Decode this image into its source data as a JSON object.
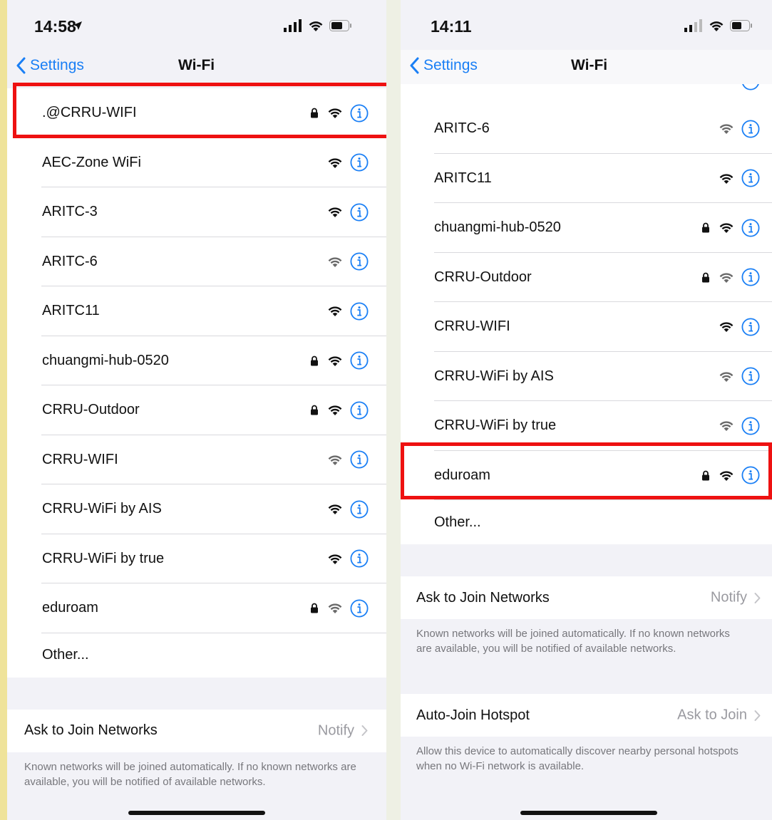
{
  "left": {
    "status": {
      "time": "14:58"
    },
    "nav": {
      "back_label": "Settings",
      "title": "Wi-Fi"
    },
    "networks": [
      {
        "name": ".@CRRU-WIFI",
        "secured": true
      },
      {
        "name": "AEC-Zone WiFi",
        "secured": false
      },
      {
        "name": "ARITC-3",
        "secured": false
      },
      {
        "name": "ARITC-6",
        "secured": false
      },
      {
        "name": "ARITC11",
        "secured": false
      },
      {
        "name": "chuangmi-hub-0520",
        "secured": true
      },
      {
        "name": "CRRU-Outdoor",
        "secured": true
      },
      {
        "name": "CRRU-WIFI",
        "secured": false
      },
      {
        "name": "CRRU-WiFi by AIS",
        "secured": false
      },
      {
        "name": "CRRU-WiFi by true",
        "secured": false
      },
      {
        "name": "eduroam",
        "secured": true
      }
    ],
    "other_label": "Other...",
    "ask_to_join": {
      "label": "Ask to Join Networks",
      "value": "Notify",
      "footnote": "Known networks will be joined automatically. If no known networks are available, you will be notified of available networks."
    }
  },
  "right": {
    "status": {
      "time": "14:11"
    },
    "nav": {
      "back_label": "Settings",
      "title": "Wi-Fi"
    },
    "networks": [
      {
        "name": "ARITC-6",
        "secured": false
      },
      {
        "name": "ARITC11",
        "secured": false
      },
      {
        "name": "chuangmi-hub-0520",
        "secured": true
      },
      {
        "name": "CRRU-Outdoor",
        "secured": true
      },
      {
        "name": "CRRU-WIFI",
        "secured": false
      },
      {
        "name": "CRRU-WiFi by AIS",
        "secured": false
      },
      {
        "name": "CRRU-WiFi by true",
        "secured": false
      },
      {
        "name": "eduroam",
        "secured": true
      }
    ],
    "other_label": "Other...",
    "ask_to_join": {
      "label": "Ask to Join Networks",
      "value": "Notify",
      "footnote": "Known networks will be joined automatically. If no known networks are available, you will be notified of available networks."
    },
    "auto_join_hotspot": {
      "label": "Auto-Join Hotspot",
      "value": "Ask to Join",
      "footnote": "Allow this device to automatically discover nearby personal hotspots when no Wi-Fi network is available."
    }
  },
  "colors": {
    "accent": "#1a7ff5",
    "highlight": "#ee1111",
    "text": "#111111",
    "secondary": "#9a9aa0"
  },
  "icons": {
    "lock": "lock-icon",
    "wifi": "wifi-icon",
    "info": "info-icon",
    "back": "chevron-left-icon",
    "disclosure": "chevron-right-icon"
  }
}
